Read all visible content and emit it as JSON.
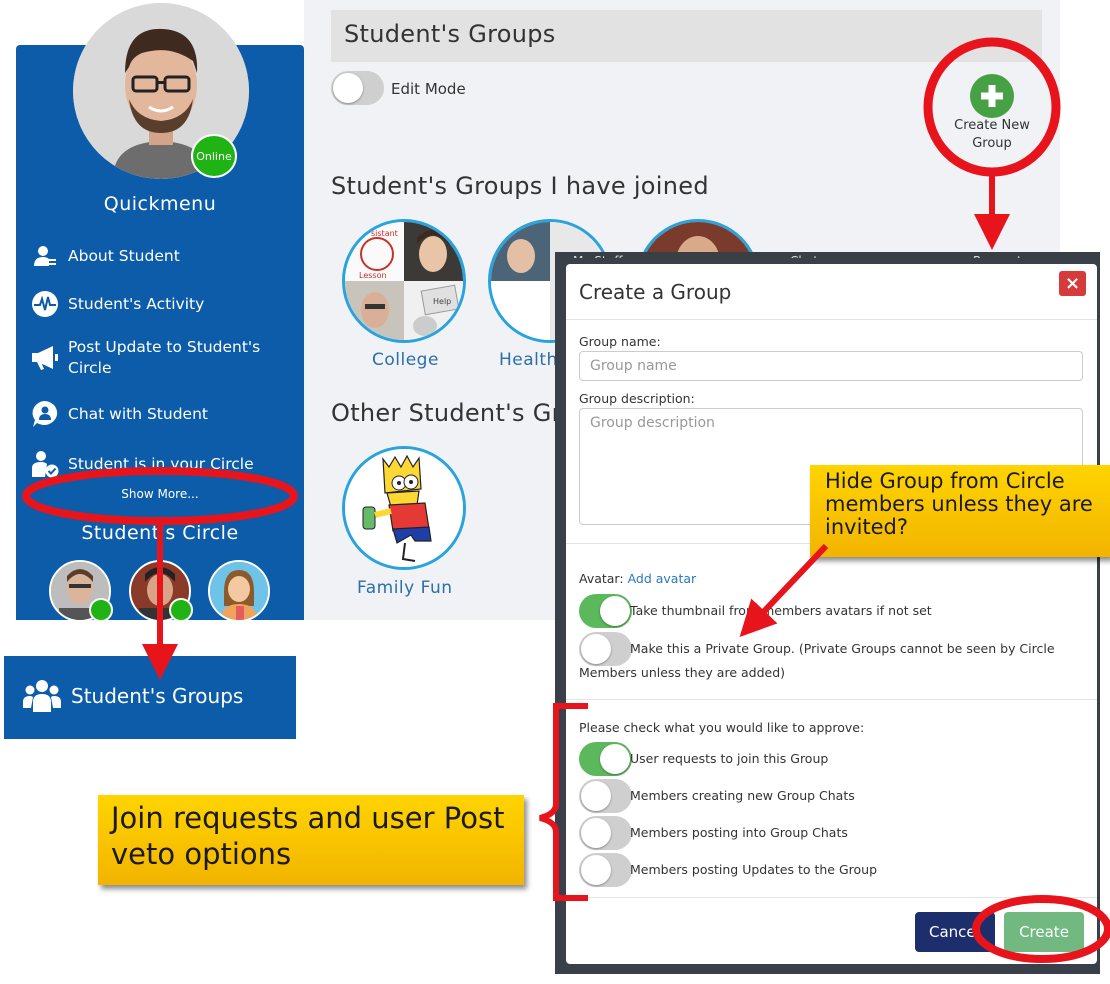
{
  "sidebar": {
    "online_badge": "Online",
    "quickmenu_title": "Quickmenu",
    "items": [
      {
        "label": "About Student",
        "icon": "user-info-icon"
      },
      {
        "label": "Student's Activity",
        "icon": "activity-icon"
      },
      {
        "label": "Post Update to Student's Circle",
        "icon": "megaphone-icon"
      },
      {
        "label": "Chat with Student",
        "icon": "chat-icon"
      },
      {
        "label": "Student is in your Circle",
        "icon": "user-check-icon"
      }
    ],
    "show_more": "Show More...",
    "circle_title": "Student's Circle",
    "groups_item": "Student's Groups"
  },
  "main": {
    "header_title": "Student's Groups",
    "edit_mode_label": "Edit Mode",
    "create_new_group": "Create New Group",
    "joined_title": "Student's Groups I have joined",
    "joined_groups": [
      {
        "name": "College"
      },
      {
        "name": "Health"
      }
    ],
    "other_title": "Other Student's Gro",
    "other_groups": [
      {
        "name": "Family Fun"
      }
    ],
    "tabs": [
      "My Stuff",
      "Chats",
      "Requests"
    ]
  },
  "modal": {
    "title": "Create a Group",
    "close": "×",
    "group_name_label": "Group name:",
    "group_name_placeholder": "Group name",
    "group_desc_label": "Group description:",
    "group_desc_placeholder": "Group description",
    "avatar_label": "Avatar:",
    "add_avatar_link": "Add avatar",
    "thumbnail_toggle": {
      "label": "Take thumbnail from members avatars if not set",
      "on": true
    },
    "private_toggle": {
      "label": "Make this a Private Group. (Private Groups cannot be seen by Circle",
      "label_cont": "Members unless they are added)",
      "on": false
    },
    "approve_title": "Please check what you would like to approve:",
    "approvals": [
      {
        "label": "User requests to join this Group",
        "on": true
      },
      {
        "label": "Members creating new Group Chats",
        "on": false
      },
      {
        "label": "Members posting into Group Chats",
        "on": false
      },
      {
        "label": "Members posting Updates to the Group",
        "on": false
      }
    ],
    "cancel_button": "Cancel",
    "create_button": "Create"
  },
  "annotations": {
    "hide_callout": "Hide Group from Circle members unless they are invited?",
    "join_callout": "Join requests  and user Post veto options"
  },
  "colors": {
    "sidebar_blue": "#0c5caa",
    "toggle_green": "#5cb85c",
    "online_green": "#1fb313",
    "annotation_red": "#e8141b",
    "callout_yellow": "#ffd400",
    "group_ring": "#29a3dd"
  }
}
